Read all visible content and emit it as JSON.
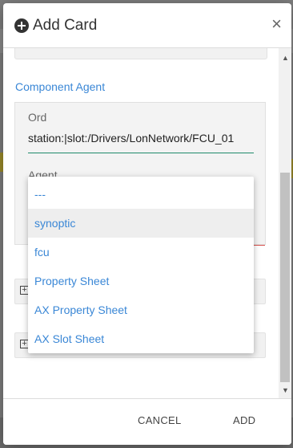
{
  "dialog": {
    "title": "Add Card",
    "close_label": "×",
    "section_label": "Component Agent",
    "ord_label": "Ord",
    "ord_value": "station:|slot:/Drivers/LonNetwork/FCU_01",
    "agent_label": "Agent",
    "cancel_label": "CANCEL",
    "add_label": "ADD"
  },
  "icons": {
    "title_icon": "plus-circle-icon",
    "close_icon": "close-icon",
    "expand_icon": "plus-square-icon",
    "scroll_up_icon": "triangle-up-icon",
    "scroll_down_icon": "triangle-down-icon"
  },
  "dropdown": {
    "selected": "synoptic",
    "options": [
      "---",
      "synoptic",
      "fcu",
      "Property Sheet",
      "AX Property Sheet",
      "AX Slot Sheet"
    ]
  },
  "colors": {
    "link": "#3a87d6",
    "ord_underline": "#1f8a6a",
    "agent_underline_error": "#d9534f",
    "selected_option_bg": "#eeeeee"
  }
}
